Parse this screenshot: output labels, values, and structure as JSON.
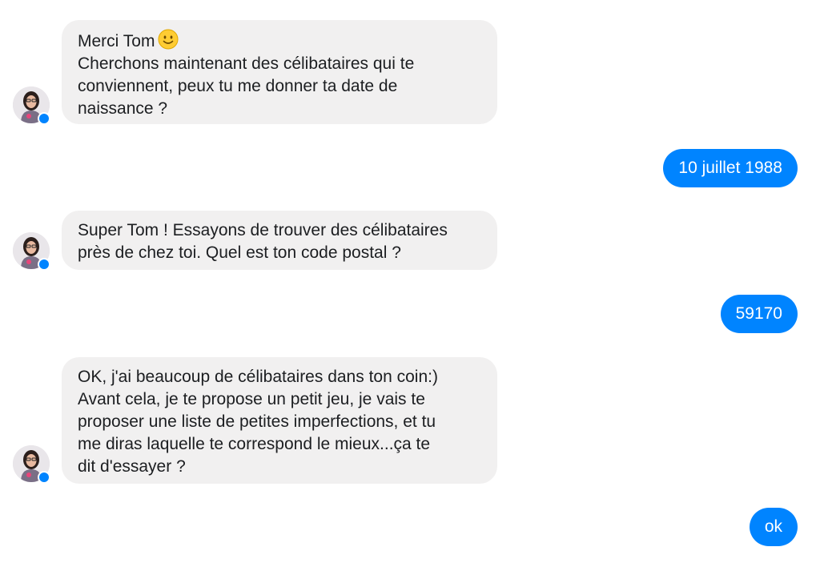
{
  "conversation": {
    "messages": [
      {
        "sender": "bot",
        "first_line": "Merci Tom",
        "emoji": "slightly-smiling-face-icon",
        "text": "Cherchons maintenant des célibataires qui te\nconviennent, peux tu me donner ta date de\nnaissance ?"
      },
      {
        "sender": "user",
        "text": "10 juillet 1988"
      },
      {
        "sender": "bot",
        "text": "Super Tom ! Essayons de trouver des célibataires\nprès de chez toi. Quel est ton code postal ?"
      },
      {
        "sender": "user",
        "text": "59170"
      },
      {
        "sender": "bot",
        "text": "OK, j'ai beaucoup de célibataires dans ton coin:)\nAvant cela, je te propose un petit jeu, je vais te\nproposer une liste de petites imperfections, et tu\nme diras laquelle te correspond le mieux...ça te\ndit d'essayer ?"
      },
      {
        "sender": "user",
        "text": "ok"
      }
    ]
  },
  "colors": {
    "bot_bubble": "#f1f0f0",
    "user_bubble": "#0084ff",
    "messenger_badge": "#0084ff"
  }
}
